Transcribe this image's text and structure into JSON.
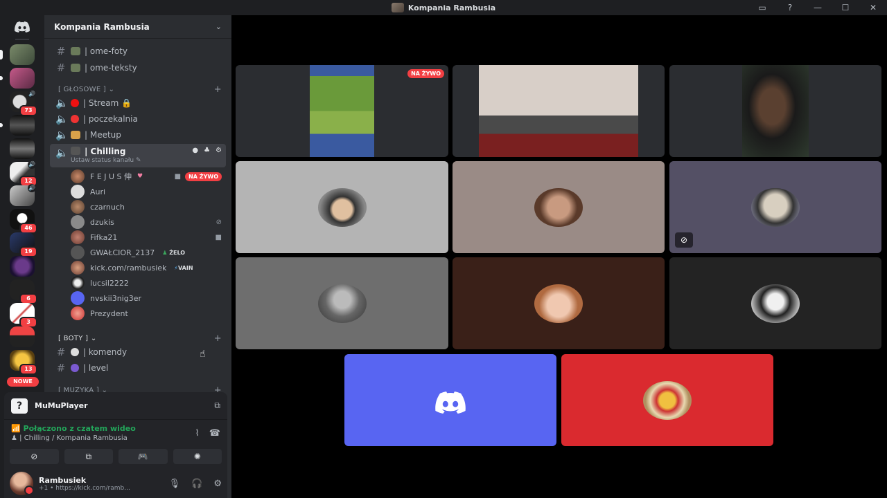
{
  "window": {
    "title": "Kompania Rambusia",
    "controls": [
      "▭",
      "?",
      "—",
      "☐",
      "✕"
    ]
  },
  "rail": {
    "home_icon": "discord-icon",
    "badges": [
      "73",
      "12",
      "46",
      "19",
      "6",
      "3",
      "13"
    ],
    "new_label": "NOWE"
  },
  "sidebar": {
    "guild_name": "Kompania Rambusia",
    "text_channels_top": [
      {
        "name": "| ome-foty"
      },
      {
        "name": "| ome-teksty"
      }
    ],
    "voice_category": "[ GŁOSOWE ]",
    "voice_channels": [
      {
        "name": "| Stream 🔒"
      },
      {
        "name": "| poczekalnia"
      },
      {
        "name": "| Meetup"
      },
      {
        "name": "| Chilling"
      }
    ],
    "set_status": "Ustaw status kanału",
    "voice_users": [
      {
        "name": "F E J U S 伸",
        "live": "NA ŻYWO",
        "tag": ""
      },
      {
        "name": "Auri",
        "tag": ""
      },
      {
        "name": "czarnuch",
        "tag": ""
      },
      {
        "name": "dzukis",
        "tag": ""
      },
      {
        "name": "Fifka21",
        "tag": ""
      },
      {
        "name": "GWAŁCIOR_2137",
        "tag": "ŻELO"
      },
      {
        "name": "kick.com/rambusiek",
        "tag": "VAIN"
      },
      {
        "name": "lucsil2222",
        "tag": ""
      },
      {
        "name": "nvskii3nig3er",
        "tag": ""
      },
      {
        "name": "Prezydent",
        "tag": ""
      }
    ],
    "bots_category": "[ BOTY ]",
    "bot_channels": [
      {
        "name": "| komendy"
      },
      {
        "name": "| level"
      }
    ],
    "music_category": "[ MUZYKA ]"
  },
  "panel": {
    "app_name": "MuMuPlayer",
    "connection_status": "Połączono z czatem wideo",
    "connection_where": "| Chilling / Kompania Rambusia",
    "user_name": "Rambusiek",
    "user_status": "+1 • https://kick.com/ramb..."
  },
  "stage": {
    "live_label": "NA ŻYWO"
  },
  "colors": {
    "blurple": "#5865f2",
    "red": "#da2a2f",
    "green": "#23a55a",
    "danger": "#f23f43"
  }
}
